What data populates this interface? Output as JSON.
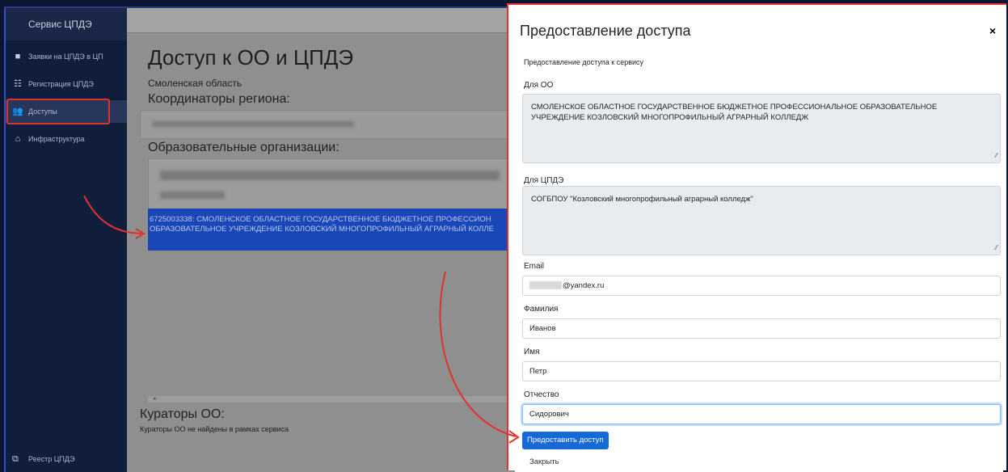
{
  "sidebar": {
    "title": "Сервис ЦПДЭ",
    "items": [
      {
        "label": "Заявки на ЦПДЭ в ЦП",
        "icon": "briefcase-icon"
      },
      {
        "label": "Регистрация ЦПДЭ",
        "icon": "list-icon"
      },
      {
        "label": "Доступы",
        "icon": "users-icon"
      },
      {
        "label": "Инфраструктура",
        "icon": "home-icon"
      }
    ],
    "footer": {
      "label": "Реестр ЦПДЭ",
      "icon": "external-link-icon"
    }
  },
  "main": {
    "title": "Доступ к ОО и ЦПДЭ",
    "region": "Смоленская область",
    "coordinators_heading": "Координаторы региона:",
    "orgs_heading": "Образовательные организации:",
    "selected_org_line1": "6725003338: СМОЛЕНСКОЕ ОБЛАСТНОЕ ГОСУДАРСТВЕННОЕ БЮДЖЕТНОЕ ПРОФЕССИОН",
    "selected_org_line2": "ОБРАЗОВАТЕЛЬНОЕ УЧРЕЖДЕНИЕ КОЗЛОВСКИЙ МНОГОПРОФИЛЬНЫЙ АГРАРНЫЙ КОЛЛЕ",
    "scroll_glyph": "◂",
    "curators_heading": "Кураторы ОО:",
    "curators_text": "Кураторы ОО не найдены в рамках сервиса"
  },
  "modal": {
    "title": "Предоставление доступа",
    "close": "×",
    "subtitle": "Предоставление доступа к сервису",
    "oo_label": "Для ОО",
    "oo_value": "СМОЛЕНСКОЕ ОБЛАСТНОЕ ГОСУДАРСТВЕННОЕ БЮДЖЕТНОЕ ПРОФЕССИОНАЛЬНОЕ ОБРАЗОВАТЕЛЬНОЕ УЧРЕЖДЕНИЕ КОЗЛОВСКИЙ МНОГОПРОФИЛЬНЫЙ АГРАРНЫЙ КОЛЛЕДЖ",
    "cpde_label": "Для ЦПДЭ",
    "cpde_value": "СОГБПОУ \"Козловский многопрофильный аграрный колледж\"",
    "email_label": "Email",
    "email_value": "@yandex.ru",
    "last_name_label": "Фамилия",
    "last_name_value": "Иванов",
    "first_name_label": "Имя",
    "first_name_value": "Петр",
    "patronymic_label": "Отчество",
    "patronymic_value": "Сидорович",
    "submit_label": "Предоставить доступ",
    "close_link": "Закрыть"
  },
  "colors": {
    "sidebar_bg": "#101d3b",
    "selected_row": "#1a47b8",
    "primary_button": "#1769d6",
    "highlight_red": "#e0322d"
  }
}
